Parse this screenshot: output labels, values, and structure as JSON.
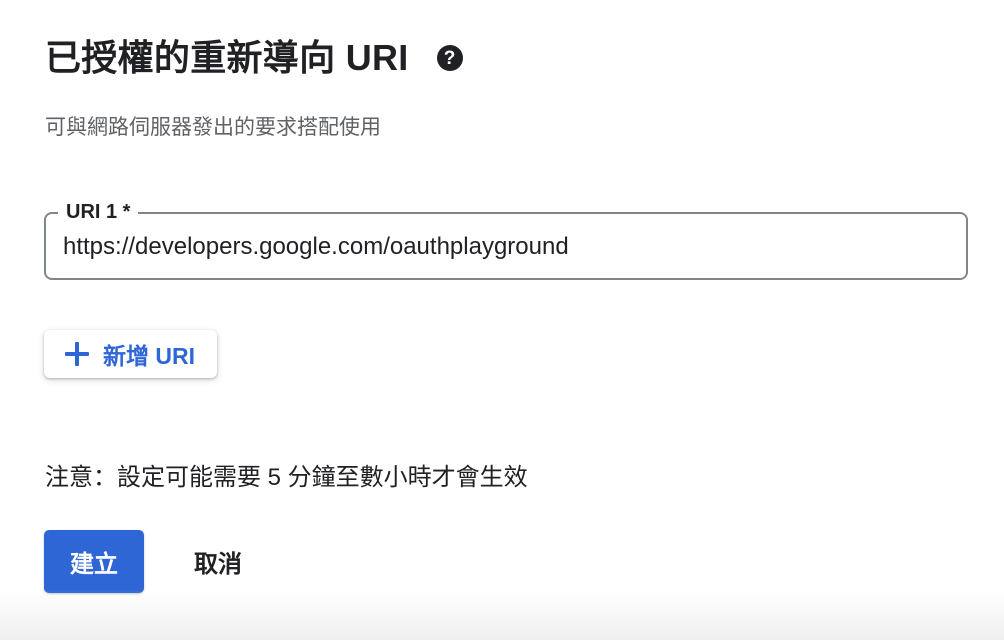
{
  "section": {
    "title": "已授權的重新導向 URI",
    "help_icon": "help-circle-icon",
    "subtitle": "可與網路伺服器發出的要求搭配使用"
  },
  "uri_fields": [
    {
      "label": "URI 1 *",
      "value": "https://developers.google.com/oauthplayground"
    }
  ],
  "add_uri": {
    "icon": "plus-icon",
    "label": "新增 URI"
  },
  "note": "注意：設定可能需要 5 分鐘至數小時才會生效",
  "actions": {
    "create_label": "建立",
    "cancel_label": "取消"
  },
  "colors": {
    "primary": "#2f66d6",
    "text": "#202124",
    "secondary_text": "#5f6368",
    "field_border": "#80868b"
  }
}
